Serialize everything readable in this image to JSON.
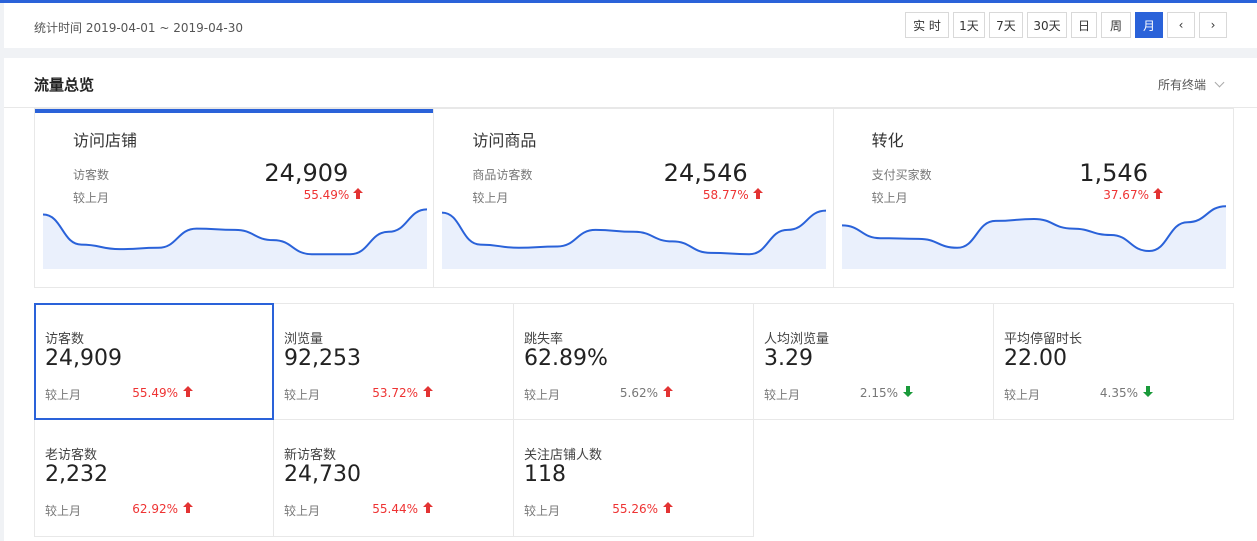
{
  "header": {
    "date_range": "统计时间 2019-04-01 ~ 2019-04-30",
    "buttons": [
      {
        "label": "实 时",
        "active": false
      },
      {
        "label": "1天",
        "active": false
      },
      {
        "label": "7天",
        "active": false
      },
      {
        "label": "30天",
        "active": false
      },
      {
        "label": "日",
        "active": false
      },
      {
        "label": "周",
        "active": false
      },
      {
        "label": "月",
        "active": true
      },
      {
        "label": "‹",
        "active": false
      },
      {
        "label": "›",
        "active": false
      }
    ]
  },
  "panel": {
    "title": "流量总览",
    "terminal": "所有终端"
  },
  "overview": [
    {
      "title": "访问店铺",
      "sub": "访客数",
      "compare": "较上月",
      "value": "24,909",
      "pct": "55.49%",
      "trend": [
        0.82,
        0.35,
        0.28,
        0.3,
        0.6,
        0.58,
        0.42,
        0.2,
        0.2,
        0.55,
        0.9
      ]
    },
    {
      "title": "访问商品",
      "sub": "商品访客数",
      "compare": "较上月",
      "value": "24,546",
      "pct": "58.77%",
      "trend": [
        0.85,
        0.35,
        0.3,
        0.32,
        0.58,
        0.55,
        0.4,
        0.22,
        0.2,
        0.58,
        0.88
      ]
    },
    {
      "title": "转化",
      "sub": "支付买家数",
      "compare": "较上月",
      "value": "1,546",
      "pct": "37.67%",
      "trend": [
        0.65,
        0.45,
        0.44,
        0.3,
        0.72,
        0.75,
        0.6,
        0.5,
        0.25,
        0.7,
        0.95
      ]
    }
  ],
  "metrics": [
    {
      "label": "访客数",
      "value": "24,909",
      "compare": "较上月",
      "pct": "55.49%",
      "dir": "up",
      "tone": "red"
    },
    {
      "label": "浏览量",
      "value": "92,253",
      "compare": "较上月",
      "pct": "53.72%",
      "dir": "up",
      "tone": "red"
    },
    {
      "label": "跳失率",
      "value": "62.89%",
      "compare": "较上月",
      "pct": "5.62%",
      "dir": "up",
      "tone": "gray"
    },
    {
      "label": "人均浏览量",
      "value": "3.29",
      "compare": "较上月",
      "pct": "2.15%",
      "dir": "down",
      "tone": "gray"
    },
    {
      "label": "平均停留时长",
      "value": "22.00",
      "compare": "较上月",
      "pct": "4.35%",
      "dir": "down",
      "tone": "gray"
    },
    {
      "label": "老访客数",
      "value": "2,232",
      "compare": "较上月",
      "pct": "62.92%",
      "dir": "up",
      "tone": "red"
    },
    {
      "label": "新访客数",
      "value": "24,730",
      "compare": "较上月",
      "pct": "55.44%",
      "dir": "up",
      "tone": "red"
    },
    {
      "label": "关注店铺人数",
      "value": "118",
      "compare": "较上月",
      "pct": "55.26%",
      "dir": "up",
      "tone": "red"
    }
  ],
  "colors": {
    "accent": "#2a62d9",
    "up": "#e33333",
    "down": "#1a9a3a"
  }
}
